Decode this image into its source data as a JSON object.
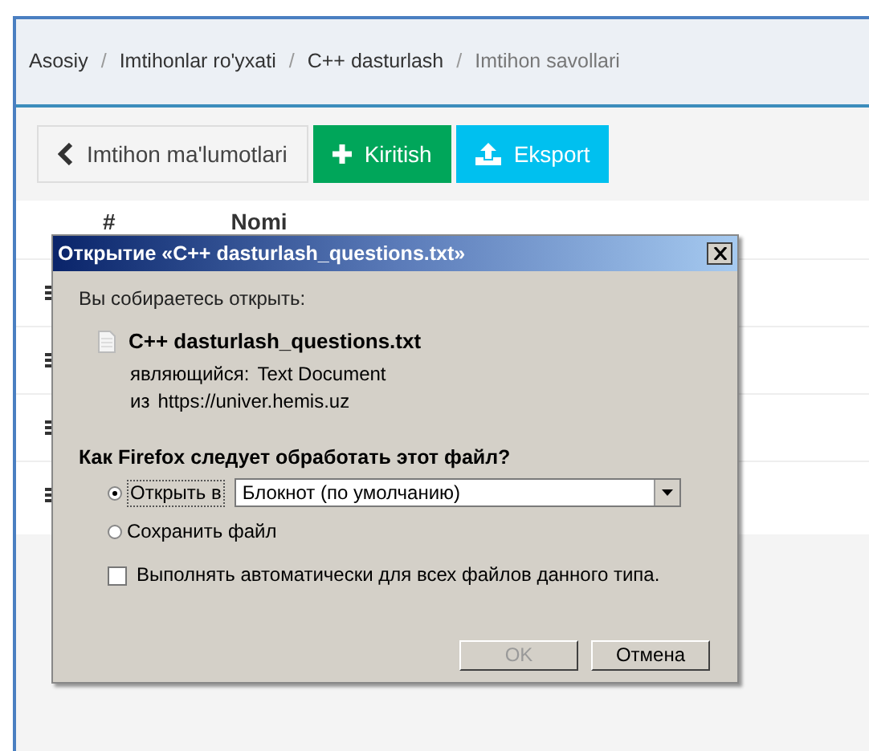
{
  "breadcrumbs": [
    {
      "label": "Asosiy",
      "selected": false
    },
    {
      "separator": "/",
      "label": "Imtihonlar ro'yxati",
      "selected": false
    },
    {
      "separator": "/",
      "label": "C++ dasturlash",
      "selected": false
    },
    {
      "separator": "/",
      "label": "Imtihon savollari",
      "selected": true
    }
  ],
  "buttons": [
    {
      "kind": "back",
      "label": "Imtihon ma'lumotlari"
    },
    {
      "kind": "add",
      "label": "Kiritish"
    },
    {
      "kind": "export",
      "label": "Eksport"
    }
  ],
  "table": {
    "columns": [
      "#",
      "Nomi"
    ]
  },
  "dialog": {
    "title": "Открытие «C++ dasturlash_questions.txt»",
    "intro": "Вы собираетесь открыть:",
    "file_name": "C++ dasturlash_questions.txt",
    "type_label": "являющийся:",
    "type_value": "Text Document",
    "from_label": "из",
    "from_value": "https://univer.hemis.uz",
    "question": "Как Firefox следует обработать этот файл?",
    "options": [
      {
        "label": "Открыть в",
        "selected": true
      },
      {
        "label": "Сохранить файл",
        "selected": false
      }
    ],
    "app_select": {
      "value": "Блокнот (по умолчанию)"
    },
    "auto": {
      "label": "Выполнять автоматически для всех файлов данного типа.",
      "checked": false
    },
    "actions": [
      {
        "label": "OK",
        "disabled": true
      },
      {
        "label": "Отмена",
        "disabled": false
      }
    ]
  }
}
